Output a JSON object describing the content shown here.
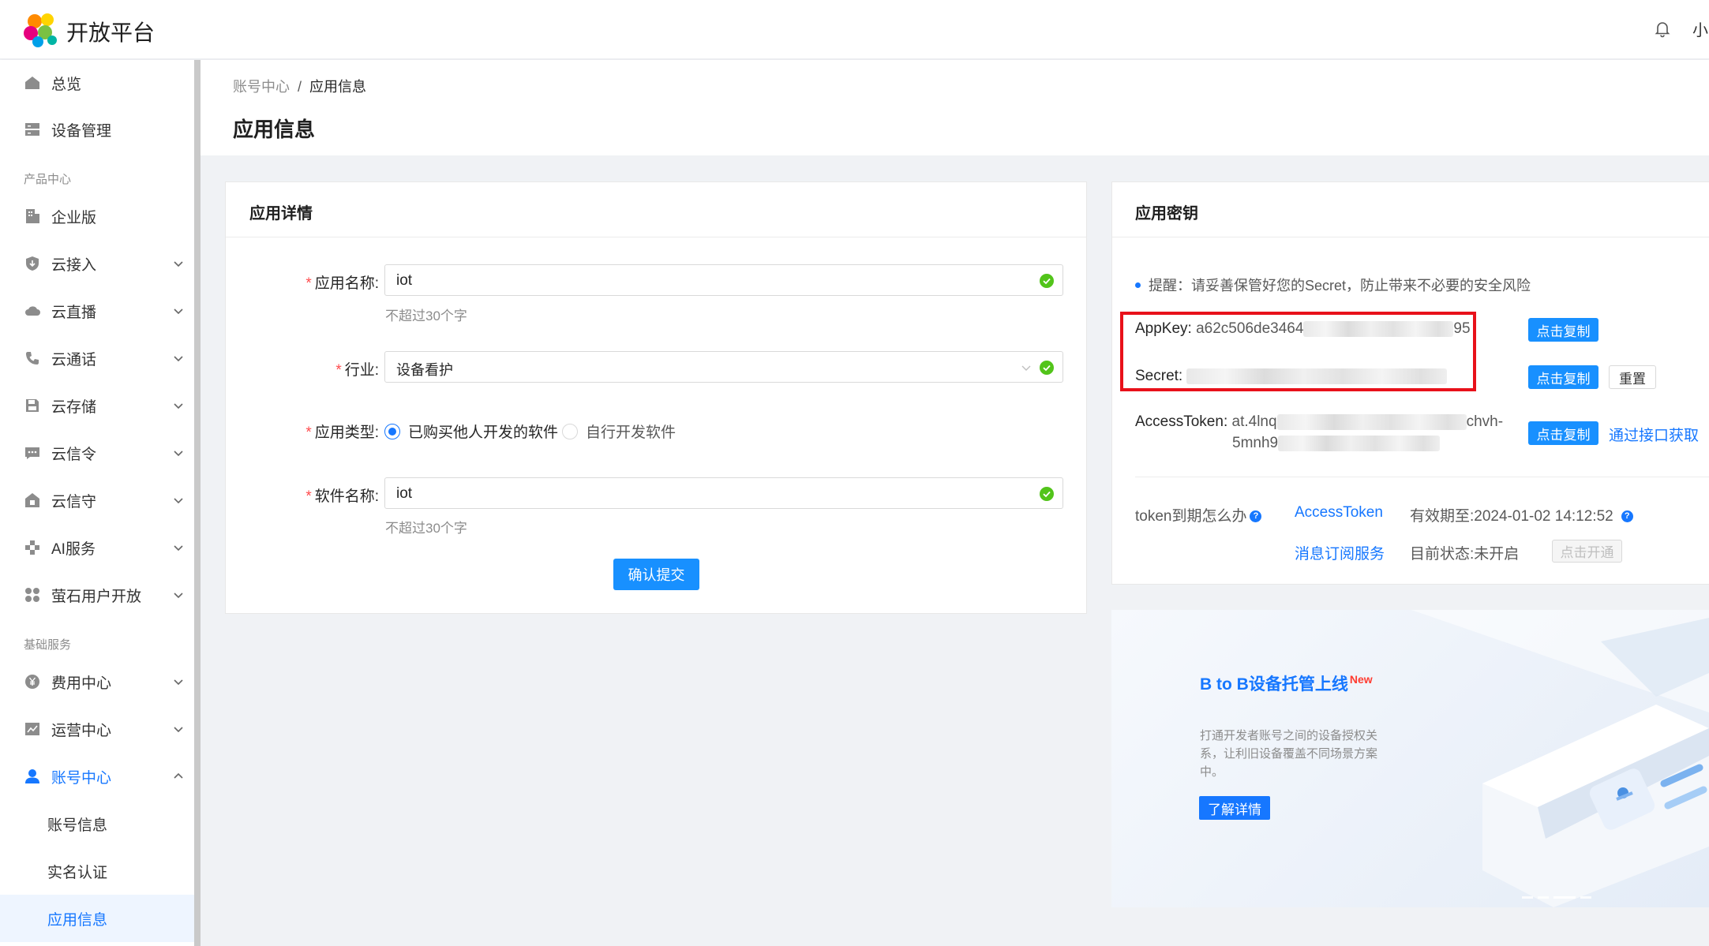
{
  "header": {
    "brand": "开放平台",
    "user_name": "小"
  },
  "sidebar": {
    "items": [
      {
        "label": "总览",
        "icon": "home-icon"
      },
      {
        "label": "设备管理",
        "icon": "server-icon"
      },
      {
        "label": "企业版",
        "icon": "building-icon"
      },
      {
        "label": "云接入",
        "icon": "shield-download-icon"
      },
      {
        "label": "云直播",
        "icon": "cloud-icon"
      },
      {
        "label": "云通话",
        "icon": "phone-icon"
      },
      {
        "label": "云存储",
        "icon": "save-icon"
      },
      {
        "label": "云信令",
        "icon": "message-icon"
      },
      {
        "label": "云信守",
        "icon": "house-shield-icon"
      },
      {
        "label": "AI服务",
        "icon": "ai-icon"
      },
      {
        "label": "萤石用户开放",
        "icon": "apps-icon"
      },
      {
        "label": "费用中心",
        "icon": "yen-icon"
      },
      {
        "label": "运营中心",
        "icon": "chart-icon"
      },
      {
        "label": "账号中心",
        "icon": "user-icon"
      }
    ],
    "sections": {
      "product": "产品中心",
      "basic": "基础服务"
    },
    "account_sub": [
      {
        "label": "账号信息"
      },
      {
        "label": "实名认证"
      },
      {
        "label": "应用信息"
      }
    ]
  },
  "breadcrumb": {
    "parent": "账号中心",
    "separator": "/",
    "current": "应用信息"
  },
  "page_title": "应用信息",
  "details_card": {
    "title": "应用详情",
    "app_name_label": "应用名称:",
    "app_name_value": "iot",
    "app_name_hint": "不超过30个字",
    "industry_label": "行业:",
    "industry_value": "设备看护",
    "app_type_label": "应用类型:",
    "app_type_option1": "已购买他人开发的软件",
    "app_type_option2": "自行开发软件",
    "software_name_label": "软件名称:",
    "software_name_value": "iot",
    "software_name_hint": "不超过30个字",
    "submit_label": "确认提交"
  },
  "keys_card": {
    "title": "应用密钥",
    "tip": "提醒：请妥善保管好您的Secret，防止带来不必要的安全风险",
    "appkey_label": "AppKey:",
    "appkey_prefix": "a62c506de3464",
    "appkey_suffix": "95",
    "secret_label": "Secret:",
    "access_token_label": "AccessToken:",
    "access_token_line1_prefix": "at.4lnq",
    "access_token_line1_suffix": "chvh-",
    "access_token_line2_prefix": "5mnh9",
    "copy_label": "点击复制",
    "reset_label": "重置",
    "get_by_api_label": "通过接口获取",
    "token_expire_question": "token到期怎么办",
    "access_token_link": "AccessToken",
    "valid_until_label": "有效期至:",
    "valid_until_value": "2024-01-02 14:12:52",
    "msg_subscribe_link": "消息订阅服务",
    "status_label": "目前状态:",
    "status_value": "未开启",
    "activate_label": "点击开通"
  },
  "banner": {
    "title": "B to B设备托管上线",
    "badge": "New",
    "desc": "打通开发者账号之间的设备授权关系，让利旧设备覆盖不同场景方案中。",
    "button": "了解详情"
  },
  "colors": {
    "primary": "#1890ff",
    "required": "#ff4d4f",
    "highlight_box": "#e8111a",
    "success": "#52c41a"
  }
}
